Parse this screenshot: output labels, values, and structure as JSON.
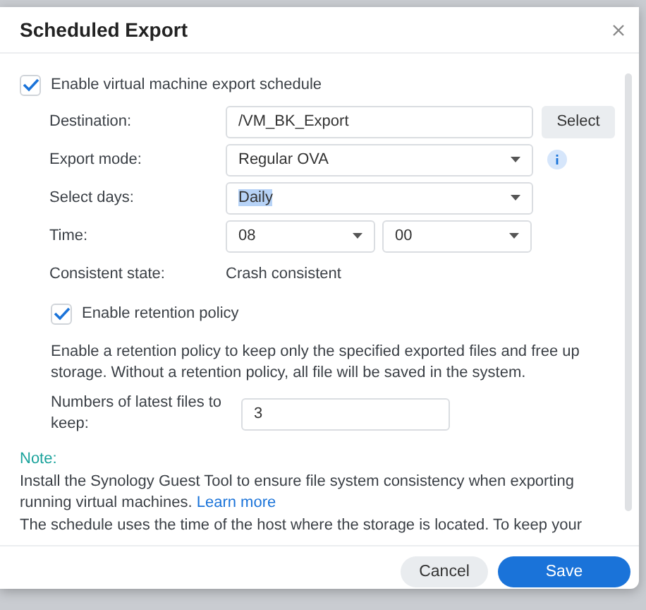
{
  "dialog": {
    "title": "Scheduled Export"
  },
  "enable_schedule": {
    "label": "Enable virtual machine export schedule",
    "checked": true
  },
  "fields": [
    {
      "kind": "text",
      "label": "Destination:",
      "value": "/VM_BK_Export",
      "button": "Select"
    },
    {
      "kind": "select",
      "label": "Export mode:",
      "value": "Regular OVA",
      "info": true
    },
    {
      "kind": "select",
      "label": "Select days:",
      "value": "Daily",
      "text_selected": true
    },
    {
      "kind": "time",
      "label": "Time:",
      "hour": "08",
      "minute": "00"
    },
    {
      "kind": "static",
      "label": "Consistent state:",
      "value": "Crash consistent"
    }
  ],
  "retention": {
    "label": "Enable retention policy",
    "checked": true,
    "description": "Enable a retention policy to keep only the specified exported files and free up storage. Without a retention policy, all file will be saved in the system.",
    "count_label": "Numbers of latest files to keep:",
    "count": "3"
  },
  "note": {
    "heading": "Note:",
    "install_text": "Install the Synology Guest Tool to ensure file system consistency when exporting running virtual machines.",
    "link": "Learn more",
    "schedule_text": "The schedule uses the time of the host where the storage is located. To keep your"
  },
  "buttons": [
    {
      "label": "Cancel",
      "kind": "secondary"
    },
    {
      "label": "Save",
      "kind": "primary"
    }
  ]
}
